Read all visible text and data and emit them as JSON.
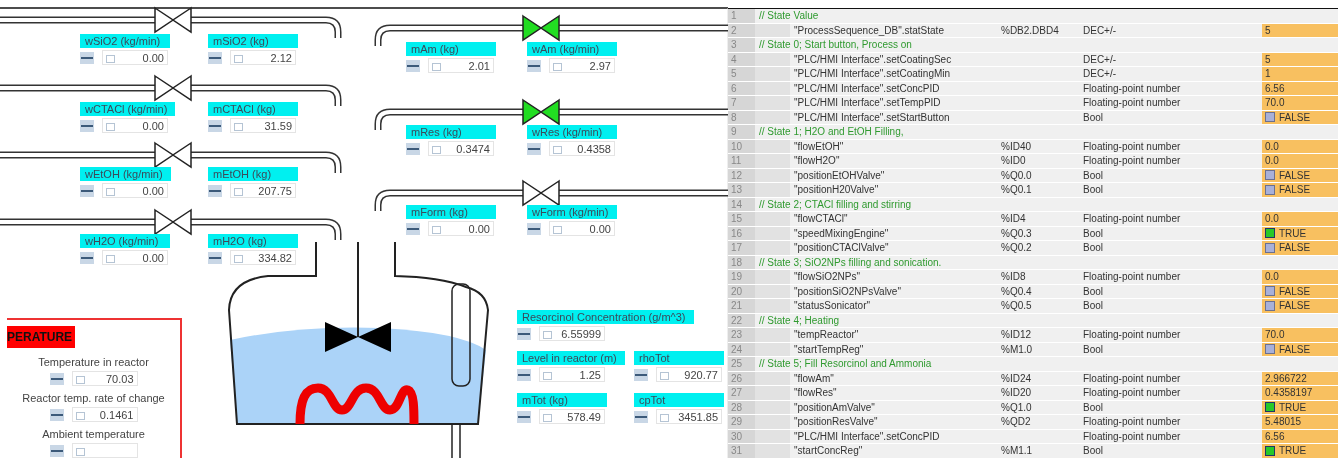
{
  "inlet_lines": [
    {
      "valve_open": false,
      "tags": [
        {
          "label": "wSiO2 (kg/min)",
          "value": "0.00"
        },
        {
          "label": "mSiO2 (kg)",
          "value": "2.12"
        }
      ]
    },
    {
      "valve_open": false,
      "tags": [
        {
          "label": "wCTACl (kg/min)",
          "value": "0.00"
        },
        {
          "label": "mCTACl (kg)",
          "value": "31.59"
        }
      ]
    },
    {
      "valve_open": false,
      "tags": [
        {
          "label": "wEtOH (kg/min)",
          "value": "0.00"
        },
        {
          "label": "mEtOH (kg)",
          "value": "207.75"
        }
      ]
    },
    {
      "valve_open": false,
      "tags": [
        {
          "label": "wH2O (kg/min)",
          "value": "0.00"
        },
        {
          "label": "mH2O (kg)",
          "value": "334.82"
        }
      ]
    }
  ],
  "feed_lines": [
    {
      "valve_open": true,
      "tags": [
        {
          "label": "mAm (kg)",
          "value": "2.01"
        },
        {
          "label": "wAm (kg/min)",
          "value": "2.97"
        }
      ]
    },
    {
      "valve_open": true,
      "tags": [
        {
          "label": "mRes (kg)",
          "value": "0.3474"
        },
        {
          "label": "wRes (kg/min)",
          "value": "0.4358"
        }
      ]
    },
    {
      "valve_open": false,
      "tags": [
        {
          "label": "mForm (kg)",
          "value": "0.00"
        },
        {
          "label": "wForm (kg/min)",
          "value": "0.00"
        }
      ]
    }
  ],
  "reactor_tags": [
    {
      "label": "Resorcinol Concentration (g/m^3)",
      "value": "6.55999"
    },
    {
      "label": "Level in reactor (m)",
      "value": "1.25"
    },
    {
      "label": "rhoTot",
      "value": "920.77"
    },
    {
      "label": "mTot (kg)",
      "value": "578.49"
    },
    {
      "label": "cpTot",
      "value": "3451.85"
    }
  ],
  "temperature_panel": {
    "title": "PERATURE",
    "readings": [
      {
        "label": "Temperature in reactor",
        "value": "70.03"
      },
      {
        "label": "Reactor temp. rate of change",
        "value": "0.1461"
      },
      {
        "label": "Ambient temperature"
      }
    ]
  },
  "watch_table": {
    "rows": [
      {
        "kind": "comment",
        "number": "1",
        "text": "// State Value"
      },
      {
        "kind": "value",
        "number": "2",
        "name": "\"ProcessSequence_DB\".statState",
        "address": "%DB2.DBD4",
        "format": "DEC+/-",
        "value": "5"
      },
      {
        "kind": "comment",
        "number": "3",
        "text": "// State 0; Start button, Process on"
      },
      {
        "kind": "value",
        "number": "4",
        "name": "\"PLC/HMI Interface\".setCoatingSec",
        "format": "DEC+/-",
        "value": "5"
      },
      {
        "kind": "value",
        "number": "5",
        "name": "\"PLC/HMI Interface\".setCoatingMin",
        "format": "DEC+/-",
        "value": "1"
      },
      {
        "kind": "value",
        "number": "6",
        "name": "\"PLC/HMI Interface\".setConcPID",
        "format": "Floating-point number",
        "value": "6.56"
      },
      {
        "kind": "value",
        "number": "7",
        "name": "\"PLC/HMI Interface\".setTempPID",
        "format": "Floating-point number",
        "value": "70.0"
      },
      {
        "kind": "bool",
        "number": "8",
        "name": "\"PLC/HMI Interface\".setStartButton",
        "format": "Bool",
        "value": "FALSE",
        "checked": false
      },
      {
        "kind": "comment",
        "number": "9",
        "text": "// State 1; H2O and EtOH Filling,"
      },
      {
        "kind": "value",
        "number": "10",
        "name": "\"flowEtOH\"",
        "address": "%ID40",
        "format": "Floating-point number",
        "value": "0.0"
      },
      {
        "kind": "value",
        "number": "11",
        "name": "\"flowH2O\"",
        "address": "%ID0",
        "format": "Floating-point number",
        "value": "0.0"
      },
      {
        "kind": "bool",
        "number": "12",
        "name": "\"positionEtOHValve\"",
        "address": "%Q0.0",
        "format": "Bool",
        "value": "FALSE",
        "checked": false
      },
      {
        "kind": "bool",
        "number": "13",
        "name": "\"positionH20Valve\"",
        "address": "%Q0.1",
        "format": "Bool",
        "value": "FALSE",
        "checked": false
      },
      {
        "kind": "comment",
        "number": "14",
        "text": "// State 2; CTACl filling and stirring"
      },
      {
        "kind": "value",
        "number": "15",
        "name": "\"flowCTACl\"",
        "address": "%ID4",
        "format": "Floating-point number",
        "value": "0.0"
      },
      {
        "kind": "bool",
        "number": "16",
        "name": "\"speedMixingEngine\"",
        "address": "%Q0.3",
        "format": "Bool",
        "value": "TRUE",
        "checked": true
      },
      {
        "kind": "bool",
        "number": "17",
        "name": "\"positionCTAClValve\"",
        "address": "%Q0.2",
        "format": "Bool",
        "value": "FALSE",
        "checked": false
      },
      {
        "kind": "comment",
        "number": "18",
        "text": "// State 3; SiO2NPs filling and sonication."
      },
      {
        "kind": "value",
        "number": "19",
        "name": "\"flowSiO2NPs\"",
        "address": "%ID8",
        "format": "Floating-point number",
        "value": "0.0"
      },
      {
        "kind": "bool",
        "number": "20",
        "name": "\"positionSiO2NPsValve\"",
        "address": "%Q0.4",
        "format": "Bool",
        "value": "FALSE",
        "checked": false
      },
      {
        "kind": "bool",
        "number": "21",
        "name": "\"statusSonicator\"",
        "address": "%Q0.5",
        "format": "Bool",
        "value": "FALSE",
        "checked": false
      },
      {
        "kind": "comment",
        "number": "22",
        "text": "// State 4;  Heating"
      },
      {
        "kind": "value",
        "number": "23",
        "name": "\"tempReactor\"",
        "address": "%ID12",
        "format": "Floating-point number",
        "value": "70.0"
      },
      {
        "kind": "bool",
        "number": "24",
        "name": "\"startTempReg\"",
        "address": "%M1.0",
        "format": "Bool",
        "value": "FALSE",
        "checked": false
      },
      {
        "kind": "comment",
        "number": "25",
        "text": "// State 5; Fill Resorcinol and Ammonia"
      },
      {
        "kind": "value",
        "number": "26",
        "name": "\"flowAm\"",
        "address": "%ID24",
        "format": "Floating-point number",
        "value": "2.966722"
      },
      {
        "kind": "value",
        "number": "27",
        "name": "\"flowRes\"",
        "address": "%ID20",
        "format": "Floating-point number",
        "value": "0.4358197"
      },
      {
        "kind": "bool",
        "number": "28",
        "name": "\"positionAmValve\"",
        "address": "%Q1.0",
        "format": "Bool",
        "value": "TRUE",
        "checked": true
      },
      {
        "kind": "value",
        "number": "29",
        "name": "\"positionResValve\"",
        "address": "%QD2",
        "format": "Floating-point number",
        "value": "5.48015"
      },
      {
        "kind": "value",
        "number": "30",
        "name": "\"PLC/HMI Interface\".setConcPID",
        "format": "Floating-point number",
        "value": "6.56"
      },
      {
        "kind": "bool",
        "number": "31",
        "name": "\"startConcReg\"",
        "address": "%M1.1",
        "format": "Bool",
        "value": "TRUE",
        "checked": true
      }
    ]
  }
}
